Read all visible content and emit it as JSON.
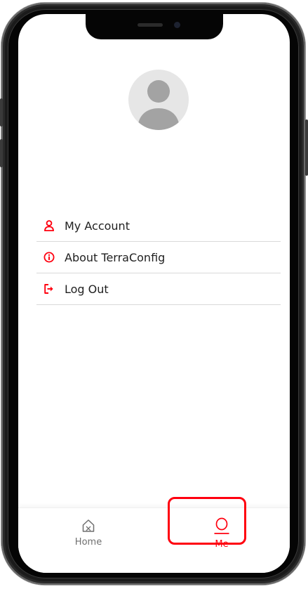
{
  "profile": {
    "avatar_icon": "user-avatar-placeholder"
  },
  "menu": {
    "items": [
      {
        "label": "My Account",
        "icon": "user-icon"
      },
      {
        "label": "About TerraConfig",
        "icon": "info-icon"
      },
      {
        "label": "Log Out",
        "icon": "logout-icon"
      }
    ]
  },
  "tabbar": {
    "tabs": [
      {
        "label": "Home",
        "icon": "home-icon",
        "active": false
      },
      {
        "label": "Me",
        "icon": "me-icon",
        "active": true
      }
    ]
  },
  "colors": {
    "accent": "#FF000F",
    "text": "#1F1F1F",
    "inactive_tab": "#6F6F6F",
    "divider": "#D9D9D9",
    "avatar_bg": "#E6E6E6",
    "avatar_fg": "#A3A3A3"
  }
}
